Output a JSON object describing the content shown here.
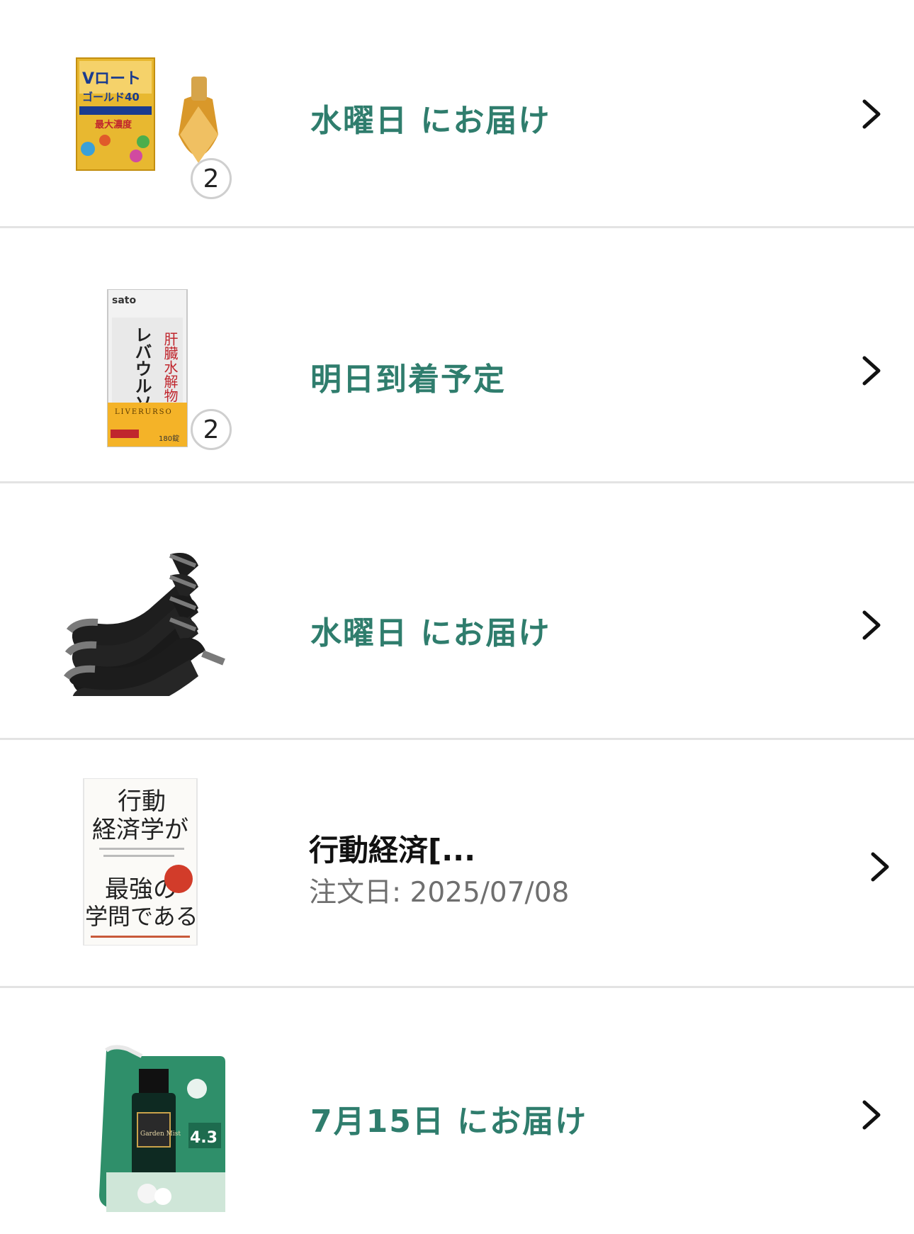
{
  "orders": [
    {
      "status": "水曜日 にお届け",
      "badge": "2",
      "product_icon": "eye-drops-product"
    },
    {
      "status": "明日到着予定",
      "badge": "2",
      "product_icon": "supplement-box-product"
    },
    {
      "status": "水曜日 にお届け",
      "product_icon": "socks-product"
    },
    {
      "title": "行動経済[...",
      "order_date": "注文日: 2025/07/08",
      "product_icon": "book-product"
    },
    {
      "status": "7月15日 にお届け",
      "product_icon": "detergent-refill-product"
    }
  ],
  "thumb_text": {
    "book": [
      "行動",
      "経済学が",
      "最強の",
      "学問である"
    ],
    "sato": "sato",
    "liver_vertical": "肝臓水解物",
    "liver_name": "レバウルソ",
    "liver_en": "LIVERURSO",
    "liver_count": "180錠",
    "eye_brand": "Vロート",
    "eye_name": "ゴールド40",
    "eye_max": "最大濃度",
    "mist_name": "Garden Mist",
    "mist_factor": "4.3"
  },
  "colors": {
    "status_green": "#2f7d6d",
    "divider": "#e3e3e3"
  }
}
